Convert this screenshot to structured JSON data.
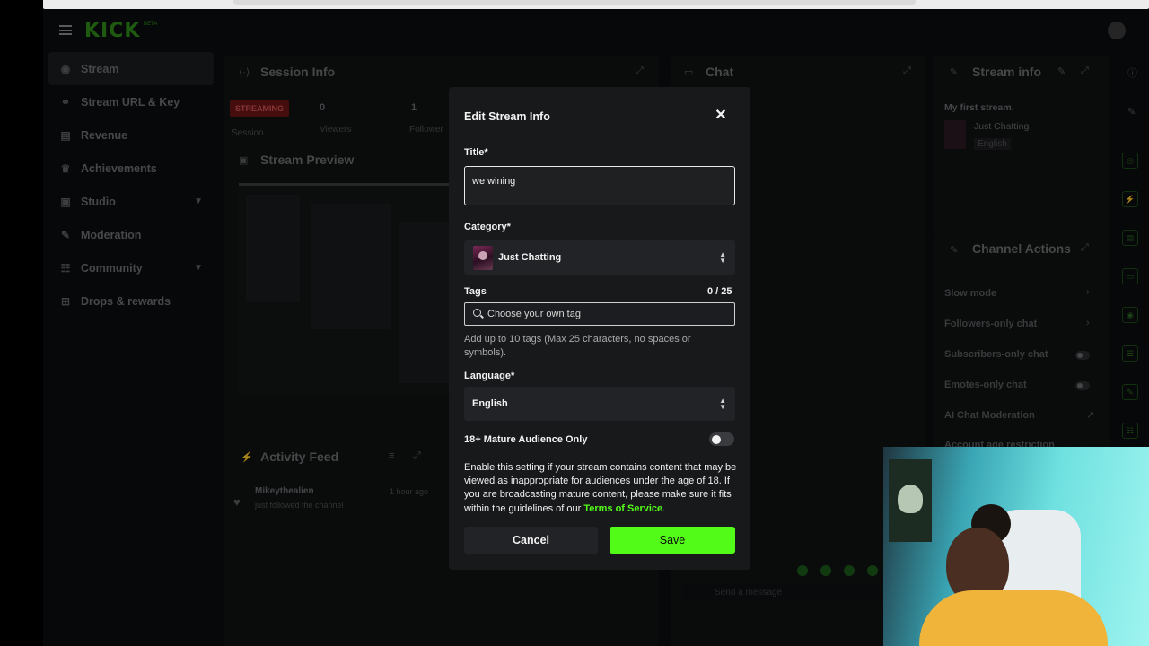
{
  "brand": {
    "logo": "KICK",
    "logo_sup": "BETA"
  },
  "sidebar": {
    "items": [
      {
        "label": "Stream"
      },
      {
        "label": "Stream URL & Key"
      },
      {
        "label": "Revenue"
      },
      {
        "label": "Achievements"
      },
      {
        "label": "Studio"
      },
      {
        "label": "Moderation"
      },
      {
        "label": "Community"
      },
      {
        "label": "Drops & rewards"
      }
    ]
  },
  "session": {
    "title": "Session Info",
    "badge": "STREAMING",
    "session_label": "Session",
    "viewers_value": "0",
    "viewers_label": "Viewers",
    "followers_value": "1",
    "followers_label": "Follower"
  },
  "preview": {
    "title": "Stream Preview"
  },
  "activity": {
    "title": "Activity Feed",
    "user": "Mikeythealien",
    "time": "1 hour ago",
    "event": "just followed the channel"
  },
  "chat": {
    "title": "Chat",
    "placeholder": "Send a message"
  },
  "stream_info": {
    "title": "Stream info",
    "stream_title": "My first stream.",
    "category": "Just Chatting",
    "language": "English"
  },
  "channel_actions": {
    "title": "Channel Actions",
    "items": [
      "Slow mode",
      "Followers-only chat",
      "Subscribers-only chat",
      "Emotes-only chat",
      "AI Chat Moderation",
      "Account age restriction"
    ]
  },
  "modal": {
    "heading": "Edit Stream Info",
    "title_label": "Title*",
    "title_value": "we wining",
    "category_label": "Category*",
    "category_value": "Just Chatting",
    "tags_label": "Tags",
    "tags_count": "0 / 25",
    "tags_placeholder": "Choose your own tag",
    "tags_help": "Add up to 10 tags (Max 25 characters, no spaces or symbols).",
    "language_label": "Language*",
    "language_value": "English",
    "mature_label": "18+ Mature Audience Only",
    "mature_enabled": false,
    "warning_text": "Enable this setting if your stream contains content that may be viewed as inappropriate for audiences under the age of 18. If you are broadcasting mature content, please make sure it fits within the guidelines of our ",
    "tos_link": "Terms of Service",
    "warning_end": ".",
    "cancel_label": "Cancel",
    "save_label": "Save"
  },
  "colors": {
    "accent": "#53fc18",
    "modal_bg": "#18191b",
    "streaming_badge": "#6a1515"
  }
}
